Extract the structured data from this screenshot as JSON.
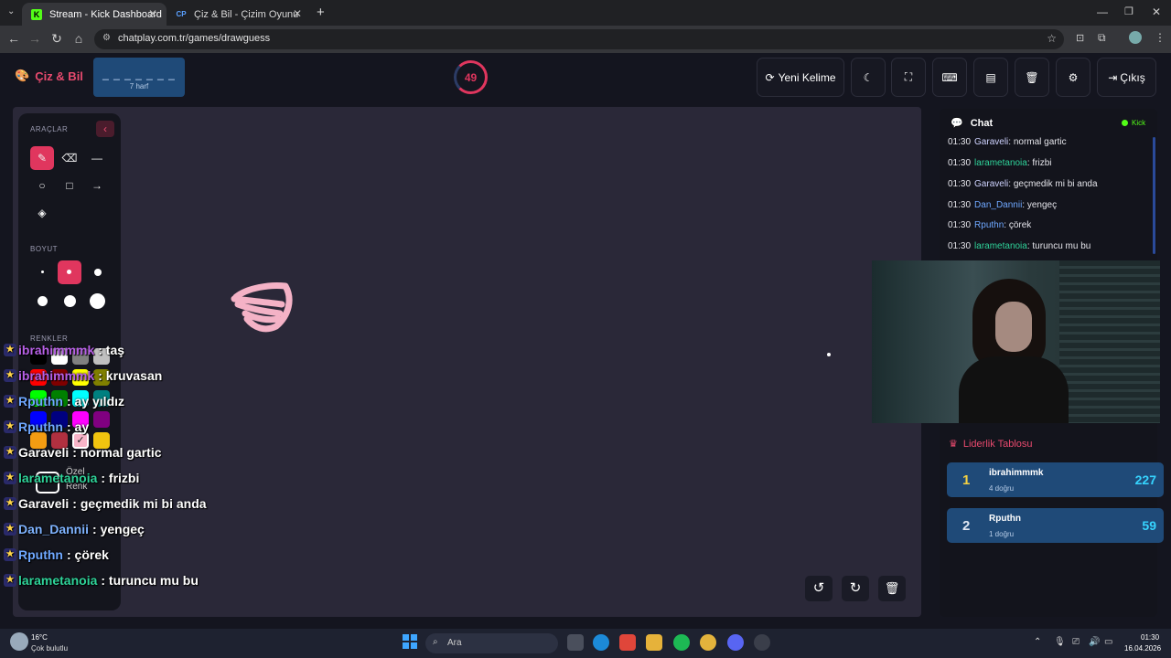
{
  "browser": {
    "tabs": [
      {
        "label": "Stream - Kick Dashboard",
        "favicon": "K"
      },
      {
        "label": "Çiz & Bil - Çizim Oyunu",
        "favicon": "CP"
      }
    ],
    "url": "chatplay.com.tr/games/drawguess"
  },
  "header": {
    "brand": "Çiz & Bil",
    "word_blanks": "_ _ _ _ _ _ _",
    "word_hint": "7 harf",
    "timer": "49",
    "new_word_label": "Yeni Kelime",
    "exit_label": "Çıkış"
  },
  "toolbox": {
    "tools_label": "ARAÇLAR",
    "size_label": "BOYUT",
    "colors_label": "RENKLER",
    "custom_color_line1": "Özel",
    "custom_color_line2": "Renk",
    "palette": [
      "#000000",
      "#ffffff",
      "#808080",
      "#c0c0c0",
      "#ff0000",
      "#800000",
      "#ffff00",
      "#808000",
      "#00ff00",
      "#008000",
      "#00ffff",
      "#008080",
      "#0000ff",
      "#000080",
      "#ff00ff",
      "#800080",
      "#f39c12",
      "#b03040",
      "#f8b4c8",
      "#f1c40f"
    ],
    "selected_color": "#f8b4c8"
  },
  "overlay_chat": [
    {
      "user": "ibrahimmmk",
      "msg": ": taş",
      "color": "#b760e6"
    },
    {
      "user": "ibrahimmmk",
      "msg": ": kruvasan",
      "color": "#b760e6"
    },
    {
      "user": "Rputhn",
      "msg": ": ay yıldız",
      "color": "#6fa8ff"
    },
    {
      "user": "Rputhn",
      "msg": ": ay",
      "color": "#6fa8ff"
    },
    {
      "user": "Garaveli",
      "msg": ": normal gartic",
      "color": "#ffffff"
    },
    {
      "user": "larametanoia",
      "msg": ": frizbi",
      "color": "#2fd39a"
    },
    {
      "user": "Garaveli",
      "msg": ": geçmedik mi bi anda",
      "color": "#ffffff"
    },
    {
      "user": "Dan_Dannii",
      "msg": ": yengeç",
      "color": "#7fb3ff"
    },
    {
      "user": "Rputhn",
      "msg": ": çörek",
      "color": "#6fa8ff"
    },
    {
      "user": "larametanoia",
      "msg": ": turuncu mu bu",
      "color": "#2fd39a"
    }
  ],
  "chat": {
    "title": "Chat",
    "platform": "Kick",
    "messages": [
      {
        "time": "01:30",
        "user": "Garaveli",
        "text": ": normal gartic",
        "color": "#cfd3ff"
      },
      {
        "time": "01:30",
        "user": "larametanoia",
        "text": ": frizbi",
        "color": "#2fd39a"
      },
      {
        "time": "01:30",
        "user": "Garaveli",
        "text": ": geçmedik mi bi anda",
        "color": "#cfd3ff"
      },
      {
        "time": "01:30",
        "user": "Dan_Dannii",
        "text": ": yengeç",
        "color": "#6fa8ff"
      },
      {
        "time": "01:30",
        "user": "Rputhn",
        "text": ": çörek",
        "color": "#6fa8ff"
      },
      {
        "time": "01:30",
        "user": "larametanoia",
        "text": ": turuncu mu bu",
        "color": "#2fd39a"
      }
    ]
  },
  "leaderboard": {
    "title": "Liderlik Tablosu",
    "rows": [
      {
        "rank": "1",
        "name": "ibrahimmmk",
        "sub": "4 doğru",
        "score": "227"
      },
      {
        "rank": "2",
        "name": "Rputhn",
        "sub": "1 doğru",
        "score": "59"
      }
    ]
  },
  "taskbar": {
    "weather_temp": "16°C",
    "weather_desc": "Çok bulutlu",
    "search_label": "Ara",
    "time": "01:30",
    "date": "16.04.2026"
  }
}
